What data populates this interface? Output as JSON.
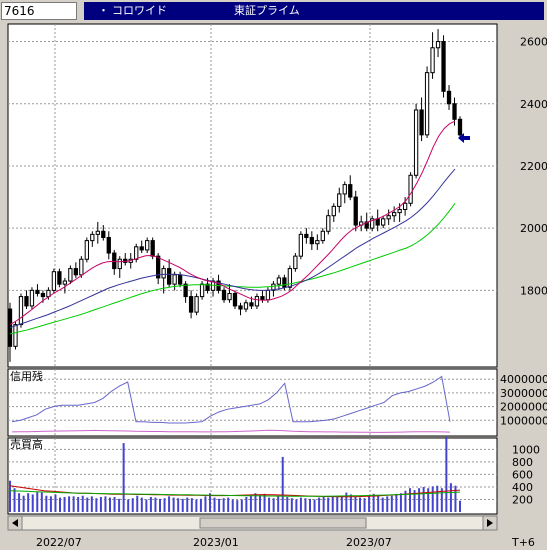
{
  "header": {
    "code": "7616",
    "bullet": "・",
    "name": "コロワイド",
    "market": "東証プライム"
  },
  "x_axis": {
    "labels": [
      "2022/07",
      "2023/01",
      "2023/07"
    ],
    "future_label": "T+6"
  },
  "colors": {
    "background": "#ffffff",
    "panel_frame": "#000000",
    "grid": "#999999",
    "candle_up": "#ffffff",
    "candle_down": "#000000",
    "ma_short": "#cc0066",
    "ma_mid": "#333399",
    "ma_long": "#00cc00",
    "margin_buy": "#6666cc",
    "margin_sell": "#cc66cc",
    "volume": "#4444cc",
    "arrow": "#000099"
  },
  "chart_data": [
    {
      "type": "candlestick",
      "panel": "price",
      "y_ticks": [
        1800,
        2000,
        2200,
        2400,
        2600
      ],
      "ylim": [
        1560,
        2650
      ],
      "current_price_marker": 2290,
      "weeks_shown": 115,
      "ohlc_weekly": [
        [
          1740,
          1760,
          1570,
          1620
        ],
        [
          1620,
          1700,
          1610,
          1690
        ],
        [
          1690,
          1790,
          1680,
          1780
        ],
        [
          1780,
          1800,
          1740,
          1750
        ],
        [
          1750,
          1810,
          1740,
          1800
        ],
        [
          1800,
          1820,
          1780,
          1790
        ],
        [
          1790,
          1800,
          1760,
          1780
        ],
        [
          1780,
          1810,
          1770,
          1800
        ],
        [
          1800,
          1870,
          1790,
          1860
        ],
        [
          1860,
          1870,
          1810,
          1820
        ],
        [
          1820,
          1840,
          1790,
          1830
        ],
        [
          1830,
          1880,
          1820,
          1870
        ],
        [
          1870,
          1890,
          1840,
          1850
        ],
        [
          1850,
          1910,
          1840,
          1900
        ],
        [
          1900,
          1970,
          1890,
          1960
        ],
        [
          1960,
          1990,
          1940,
          1980
        ],
        [
          1980,
          2020,
          1950,
          1990
        ],
        [
          1990,
          2010,
          1960,
          1970
        ],
        [
          1970,
          1990,
          1900,
          1920
        ],
        [
          1920,
          1930,
          1850,
          1870
        ],
        [
          1870,
          1910,
          1840,
          1900
        ],
        [
          1900,
          1920,
          1880,
          1890
        ],
        [
          1890,
          1920,
          1870,
          1900
        ],
        [
          1900,
          1950,
          1890,
          1940
        ],
        [
          1940,
          1960,
          1920,
          1930
        ],
        [
          1930,
          1970,
          1920,
          1960
        ],
        [
          1960,
          1970,
          1900,
          1910
        ],
        [
          1910,
          1920,
          1820,
          1840
        ],
        [
          1840,
          1880,
          1790,
          1870
        ],
        [
          1870,
          1900,
          1810,
          1820
        ],
        [
          1820,
          1860,
          1800,
          1850
        ],
        [
          1850,
          1860,
          1810,
          1820
        ],
        [
          1820,
          1830,
          1760,
          1780
        ],
        [
          1780,
          1800,
          1710,
          1730
        ],
        [
          1730,
          1790,
          1720,
          1780
        ],
        [
          1780,
          1830,
          1770,
          1820
        ],
        [
          1820,
          1840,
          1790,
          1800
        ],
        [
          1800,
          1840,
          1780,
          1830
        ],
        [
          1830,
          1850,
          1790,
          1800
        ],
        [
          1800,
          1810,
          1760,
          1770
        ],
        [
          1770,
          1820,
          1760,
          1790
        ],
        [
          1790,
          1800,
          1740,
          1750
        ],
        [
          1750,
          1760,
          1720,
          1740
        ],
        [
          1740,
          1770,
          1730,
          1760
        ],
        [
          1760,
          1780,
          1740,
          1750
        ],
        [
          1750,
          1790,
          1740,
          1780
        ],
        [
          1780,
          1800,
          1760,
          1770
        ],
        [
          1770,
          1810,
          1760,
          1800
        ],
        [
          1800,
          1830,
          1780,
          1820
        ],
        [
          1820,
          1850,
          1800,
          1840
        ],
        [
          1840,
          1850,
          1800,
          1810
        ],
        [
          1810,
          1880,
          1800,
          1870
        ],
        [
          1870,
          1920,
          1860,
          1910
        ],
        [
          1910,
          1990,
          1900,
          1980
        ],
        [
          1980,
          2000,
          1950,
          1970
        ],
        [
          1970,
          1990,
          1930,
          1950
        ],
        [
          1950,
          1980,
          1930,
          1960
        ],
        [
          1960,
          2000,
          1950,
          1990
        ],
        [
          1990,
          2060,
          1980,
          2040
        ],
        [
          2040,
          2080,
          2020,
          2070
        ],
        [
          2070,
          2130,
          2050,
          2110
        ],
        [
          2110,
          2150,
          2080,
          2140
        ],
        [
          2140,
          2170,
          2090,
          2100
        ],
        [
          2100,
          2120,
          1990,
          2010
        ],
        [
          2010,
          2040,
          1990,
          2020
        ],
        [
          2020,
          2050,
          1990,
          2000
        ],
        [
          2000,
          2040,
          1990,
          2030
        ],
        [
          2030,
          2060,
          1990,
          2010
        ],
        [
          2010,
          2040,
          2000,
          2030
        ],
        [
          2030,
          2060,
          2010,
          2040
        ],
        [
          2040,
          2070,
          2020,
          2050
        ],
        [
          2050,
          2080,
          2020,
          2060
        ],
        [
          2060,
          2100,
          2040,
          2080
        ],
        [
          2080,
          2180,
          2070,
          2170
        ],
        [
          2170,
          2400,
          2160,
          2380
        ],
        [
          2380,
          2420,
          2280,
          2300
        ],
        [
          2300,
          2520,
          2290,
          2500
        ],
        [
          2500,
          2630,
          2480,
          2580
        ],
        [
          2580,
          2640,
          2550,
          2600
        ],
        [
          2600,
          2620,
          2420,
          2440
        ],
        [
          2440,
          2460,
          2380,
          2400
        ],
        [
          2400,
          2420,
          2330,
          2350
        ],
        [
          2350,
          2360,
          2290,
          2300
        ]
      ],
      "ma_short": [
        1690,
        1700,
        1712,
        1725,
        1738,
        1752,
        1766,
        1778,
        1790,
        1800,
        1810,
        1822,
        1834,
        1846,
        1858,
        1870,
        1880,
        1888,
        1892,
        1893,
        1892,
        1893,
        1895,
        1900,
        1906,
        1911,
        1912,
        1908,
        1900,
        1892,
        1884,
        1876,
        1866,
        1855,
        1846,
        1838,
        1832,
        1828,
        1825,
        1818,
        1808,
        1800,
        1792,
        1784,
        1776,
        1771,
        1769,
        1768,
        1770,
        1775,
        1781,
        1790,
        1802,
        1818,
        1834,
        1850,
        1868,
        1886,
        1904,
        1922,
        1942,
        1962,
        1980,
        1994,
        2004,
        2012,
        2020,
        2026,
        2032,
        2040,
        2050,
        2060,
        2072,
        2090,
        2116,
        2146,
        2180,
        2220,
        2262,
        2296,
        2320,
        2336,
        2344
      ],
      "ma_mid": [
        1680,
        1686,
        1692,
        1698,
        1704,
        1710,
        1716,
        1722,
        1729,
        1736,
        1743,
        1750,
        1758,
        1766,
        1774,
        1782,
        1790,
        1798,
        1806,
        1812,
        1818,
        1823,
        1828,
        1833,
        1838,
        1842,
        1846,
        1849,
        1851,
        1852,
        1852,
        1851,
        1849,
        1846,
        1842,
        1838,
        1834,
        1830,
        1826,
        1822,
        1818,
        1814,
        1810,
        1806,
        1803,
        1801,
        1800,
        1800,
        1801,
        1803,
        1806,
        1810,
        1815,
        1821,
        1828,
        1836,
        1845,
        1855,
        1866,
        1878,
        1890,
        1902,
        1914,
        1926,
        1938,
        1948,
        1958,
        1968,
        1977,
        1986,
        1995,
        2004,
        2014,
        2024,
        2036,
        2050,
        2066,
        2084,
        2104,
        2126,
        2148,
        2170,
        2190
      ],
      "ma_long": [
        1660,
        1664,
        1668,
        1672,
        1677,
        1682,
        1687,
        1692,
        1697,
        1702,
        1707,
        1712,
        1717,
        1722,
        1728,
        1734,
        1740,
        1746,
        1752,
        1758,
        1764,
        1770,
        1776,
        1782,
        1788,
        1793,
        1798,
        1802,
        1806,
        1809,
        1812,
        1814,
        1816,
        1817,
        1818,
        1818,
        1818,
        1817,
        1816,
        1815,
        1814,
        1813,
        1812,
        1811,
        1810,
        1810,
        1810,
        1811,
        1812,
        1814,
        1816,
        1819,
        1822,
        1826,
        1830,
        1834,
        1838,
        1843,
        1848,
        1853,
        1858,
        1864,
        1870,
        1876,
        1882,
        1888,
        1894,
        1900,
        1906,
        1912,
        1918,
        1924,
        1930,
        1936,
        1944,
        1954,
        1966,
        1980,
        1996,
        2014,
        2034,
        2056,
        2080
      ]
    },
    {
      "type": "line",
      "panel": "margin_balance",
      "label": "信用残",
      "y_ticks": [
        1000000,
        2000000,
        3000000,
        4000000
      ],
      "ylim": [
        0,
        4600000
      ],
      "series": [
        {
          "name": "buy",
          "values": [
            900000,
            1000000,
            1200000,
            1400000,
            1800000,
            2000000,
            2100000,
            2100000,
            2100000,
            2200000,
            2300000,
            2600000,
            3100000,
            3500000,
            3800000,
            900000,
            900000,
            850000,
            850000,
            800000,
            800000,
            800000,
            850000,
            900000,
            1300000,
            1600000,
            1800000,
            1900000,
            2000000,
            2100000,
            2200000,
            2500000,
            3000000,
            3700000,
            900000,
            900000,
            900000,
            950000,
            1000000,
            1100000,
            1300000,
            1500000,
            1700000,
            1900000,
            2100000,
            2300000,
            2800000,
            3000000,
            3100000,
            3300000,
            3500000,
            3800000,
            4200000,
            900000
          ]
        },
        {
          "name": "sell",
          "values": [
            150000,
            160000,
            170000,
            180000,
            200000,
            210000,
            220000,
            230000,
            240000,
            250000,
            260000,
            250000,
            240000,
            230000,
            220000,
            200000,
            190000,
            180000,
            180000,
            170000,
            170000,
            160000,
            160000,
            150000,
            150000,
            160000,
            170000,
            180000,
            200000,
            220000,
            250000,
            270000,
            260000,
            240000,
            200000,
            180000,
            170000,
            160000,
            150000,
            150000,
            140000,
            140000,
            130000,
            130000,
            120000,
            120000,
            130000,
            140000,
            150000,
            160000,
            170000,
            160000,
            150000,
            140000
          ]
        }
      ]
    },
    {
      "type": "bar",
      "panel": "volume",
      "label": "売買高",
      "y_ticks": [
        200,
        400,
        600,
        800,
        1000
      ],
      "ylim": [
        0,
        1150
      ],
      "values": [
        500,
        380,
        300,
        260,
        300,
        280,
        320,
        310,
        260,
        250,
        280,
        230,
        240,
        250,
        250,
        240,
        260,
        230,
        250,
        220,
        240,
        250,
        230,
        240,
        210,
        1100,
        200,
        220,
        260,
        230,
        200,
        240,
        230,
        210,
        220,
        250,
        230,
        220,
        210,
        230,
        220,
        200,
        210,
        250,
        300,
        230,
        210,
        220,
        230,
        200,
        190,
        200,
        240,
        260,
        300,
        270,
        290,
        230,
        220,
        250,
        880,
        240,
        220,
        200,
        230,
        220,
        210,
        200,
        230,
        240,
        230,
        250,
        240,
        260,
        310,
        280,
        250,
        230,
        220,
        260,
        290,
        270,
        230,
        250,
        260,
        290,
        300,
        340,
        380,
        350,
        380,
        400,
        380,
        410,
        420,
        380,
        1200,
        460,
        420,
        180
      ],
      "ma_a": [
        420,
        400,
        380,
        360,
        340,
        330,
        320,
        310,
        300,
        300,
        295,
        290,
        285,
        285,
        285,
        280,
        280,
        275,
        275,
        270,
        270,
        268,
        266,
        264,
        262,
        262,
        264,
        268,
        272,
        276,
        278,
        276,
        272,
        268,
        262,
        256,
        252,
        248,
        246,
        244,
        244,
        246,
        250,
        256,
        264,
        272,
        280,
        290,
        300,
        310,
        320,
        330,
        340,
        350
      ],
      "ma_b": [
        340,
        335,
        330,
        325,
        320,
        315,
        310,
        305,
        300,
        298,
        296,
        294,
        292,
        290,
        288,
        286,
        284,
        282,
        280,
        278,
        276,
        274,
        272,
        270,
        268,
        266,
        264,
        262,
        260,
        258,
        256,
        255,
        254,
        253,
        252,
        252,
        252,
        253,
        254,
        256,
        258,
        260,
        263,
        266,
        270,
        274,
        278,
        282,
        288,
        294,
        300,
        306,
        312,
        318
      ]
    }
  ]
}
